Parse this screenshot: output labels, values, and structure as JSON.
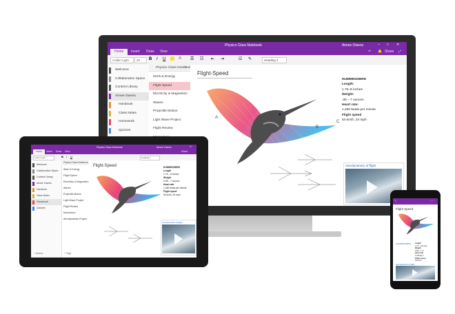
{
  "desktop": {
    "window_title": "Physics Class Notebook",
    "user_name": "Aimee Owens",
    "ribbon_tabs": [
      "Home",
      "Insert",
      "Draw",
      "View"
    ],
    "share_label": "Share",
    "font_name": "Calibri Light",
    "font_size": "20",
    "style_label": "Heading 1",
    "notebook_title": "Physics Class Notebook",
    "sections": [
      {
        "label": "Welcome",
        "color": "#4b4b4b"
      },
      {
        "label": "Collaboration Space",
        "color": "#8a8a8a"
      },
      {
        "label": "Content Library",
        "color": "#555555"
      },
      {
        "label": "Aimee Owens",
        "color": "#7b2aa7"
      },
      {
        "label": "Handouts",
        "color": "#e2932f"
      },
      {
        "label": "Class Notes",
        "color": "#d7b22f"
      },
      {
        "label": "Homework",
        "color": "#e0485c"
      },
      {
        "label": "Quizzes",
        "color": "#3d8be0"
      }
    ],
    "pages": [
      "Work & Energy",
      "Flight Speed",
      "Electricity & Magnetism",
      "Waves",
      "Projectile Motion",
      "Light Wave Project",
      "Flight Review",
      "Momentum"
    ],
    "page_title": "Flight-Speed",
    "facts": {
      "heading": "HUMMINGBIRD",
      "length_label": "Length:",
      "length_value": "1.75–8 inches",
      "weight_label": "Weight:",
      "weight_value": ".08 – 7 ounces",
      "heart_label": "Heart rate:",
      "heart_value": "1,260 beats per minute",
      "speed_label": "Flight speed",
      "speed_value": "54 km/h, 34 mph"
    },
    "video_title": "Aerodynamics of flight",
    "labels": {
      "a": "A",
      "b": "B",
      "c": "C"
    }
  },
  "tablet": {
    "window_title": "Physics Class Notebook",
    "user_name": "Aimee Owens",
    "share_label": "Share",
    "ribbon_tabs": [
      "Home",
      "Insert",
      "Draw",
      "View"
    ],
    "font_name": "Calibri Light",
    "style_label": "Heading 1",
    "notebook_title": "Physics Class Notebook",
    "sections": [
      "Welcome",
      "Collaboration Space",
      "Content Library",
      "Aimee Owens",
      "Handouts",
      "Class Notes",
      "Homework",
      "Quizzes"
    ],
    "pages": [
      "Work & Energy",
      "Flight Speed",
      "Electricity & Magnetism",
      "Waves",
      "Projectile Motion",
      "Light Wave Project",
      "Flight Review",
      "Momentum",
      "Aerodynamics Project"
    ],
    "page_title": "Flight-Speed",
    "facts": [
      "HUMMINGBIRD",
      "Length",
      "1.75 – 8 inches",
      "Weight",
      "0.08 – 7 ounces",
      "Heart rate",
      "1,260 beats per minute",
      "Flight speed",
      "54 km/h, 34 mph"
    ],
    "video_title": "Aerodynamics of flight",
    "add_section": "+ Section",
    "add_page": "+ Page"
  },
  "phone": {
    "page_title": "Flight Speed",
    "caption": "HUMMINGBIRD",
    "video_title": "Aerodynamics of flight",
    "facts": [
      "Length",
      "1.75 – 8 inches",
      "Weight",
      "0.08 – 7 oz",
      "Heart rate",
      "1,260 bpm",
      "Flight speed",
      "54 km/h"
    ]
  },
  "colors": {
    "accent": "#7b2aa7",
    "selected_page": "#f7c5cc"
  }
}
